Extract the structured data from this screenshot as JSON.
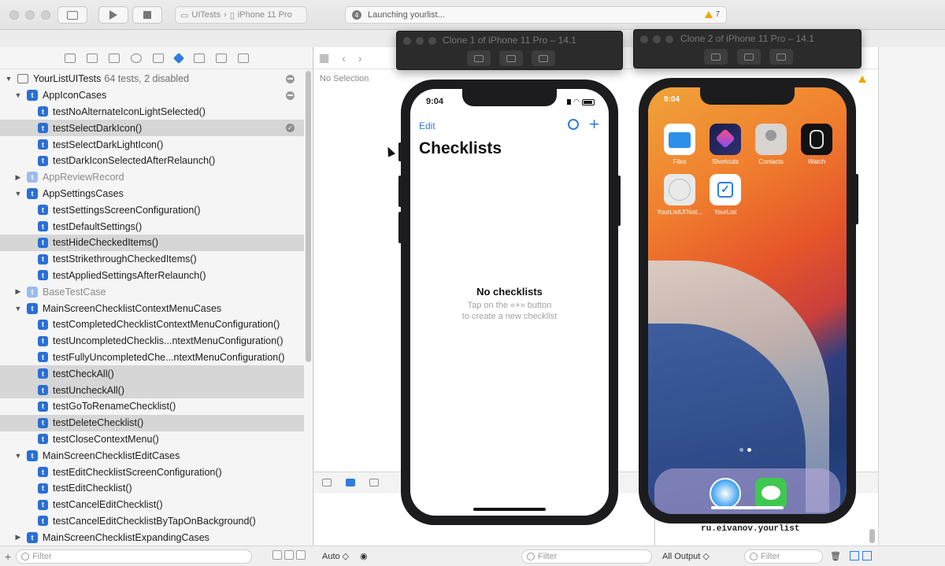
{
  "toolbar": {
    "scheme": "UITests",
    "device": "iPhone 11 Pro",
    "activity_count": "4",
    "activity_text": "Launching yourlist...",
    "warnings": "7"
  },
  "navigator": {
    "root": {
      "name": "YourListUITests",
      "meta": "64 tests, 2 disabled"
    },
    "items": [
      {
        "label": "AppIconCases"
      },
      {
        "label": "testNoAlternateIconLightSelected()"
      },
      {
        "label": "testSelectDarkIcon()"
      },
      {
        "label": "testSelectDarkLightIcon()"
      },
      {
        "label": "testDarkIconSelectedAfterRelaunch()"
      },
      {
        "label": "AppReviewRecord"
      },
      {
        "label": "AppSettingsCases"
      },
      {
        "label": "testSettingsScreenConfiguration()"
      },
      {
        "label": "testDefaultSettings()"
      },
      {
        "label": "testHideCheckedItems()"
      },
      {
        "label": "testStrikethroughCheckedItems()"
      },
      {
        "label": "testAppliedSettingsAfterRelaunch()"
      },
      {
        "label": "BaseTestCase"
      },
      {
        "label": "MainScreenChecklistContextMenuCases"
      },
      {
        "label": "testCompletedChecklistContextMenuConfiguration()"
      },
      {
        "label": "testUncompletedChecklis...ntextMenuConfiguration()"
      },
      {
        "label": "testFullyUncompletedChe...ntextMenuConfiguration()"
      },
      {
        "label": "testCheckAll()"
      },
      {
        "label": "testUncheckAll()"
      },
      {
        "label": "testGoToRenameChecklist()"
      },
      {
        "label": "testDeleteChecklist()"
      },
      {
        "label": "testCloseContextMenu()"
      },
      {
        "label": "MainScreenChecklistEditCases"
      },
      {
        "label": "testEditChecklistScreenConfiguration()"
      },
      {
        "label": "testEditChecklist()"
      },
      {
        "label": "testCancelEditChecklist()"
      },
      {
        "label": "testCancelEditChecklistByTapOnBackground()"
      },
      {
        "label": "MainScreenChecklistExpandingCases"
      }
    ],
    "filter_placeholder": "Filter",
    "test_glyph": "t"
  },
  "editor": {
    "no_selection": "No Selection"
  },
  "debug": {
    "auto_label": "Auto ◇",
    "filter_left": "Filter",
    "output_label": "All Output ◇",
    "filter_right": "Filter",
    "console_text": "ru.eivanov.yourlist"
  },
  "sim1": {
    "title": "Clone 1 of iPhone 11 Pro – 14.1",
    "time": "9:04",
    "edit": "Edit",
    "plus": "+",
    "heading": "Checklists",
    "empty_title": "No checklists",
    "empty_line1": "Tap on the «+» button",
    "empty_line2": "to create a new checklist"
  },
  "sim2": {
    "title": "Clone 2 of iPhone 11 Pro – 14.1",
    "time": "9:04",
    "apps": [
      {
        "label": "Files"
      },
      {
        "label": "Shortcuts"
      },
      {
        "label": "Contacts"
      },
      {
        "label": "Watch"
      },
      {
        "label": "YourListUITest..."
      },
      {
        "label": "YourList"
      }
    ]
  }
}
